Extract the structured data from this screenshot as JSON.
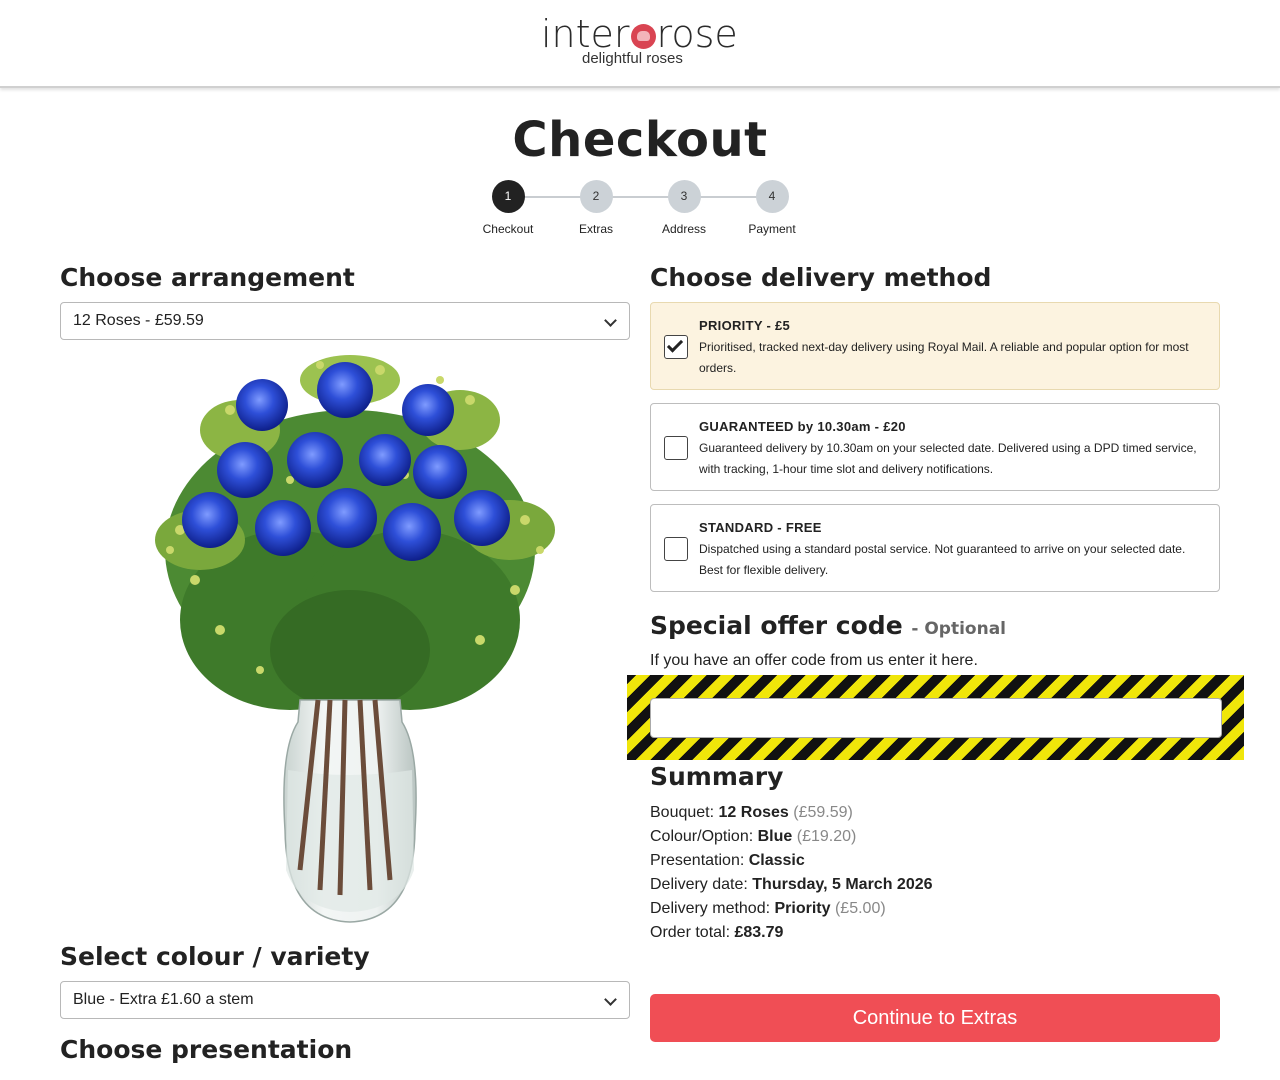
{
  "brand": {
    "name_prefix": "inter",
    "name_suffix": "rose",
    "tagline": "delightful roses"
  },
  "page": {
    "title": "Checkout"
  },
  "steps": [
    {
      "number": "1",
      "label": "Checkout",
      "active": true
    },
    {
      "number": "2",
      "label": "Extras",
      "active": false
    },
    {
      "number": "3",
      "label": "Address",
      "active": false
    },
    {
      "number": "4",
      "label": "Payment",
      "active": false
    }
  ],
  "arrangement": {
    "heading": "Choose arrangement",
    "selected": "12 Roses - £59.59"
  },
  "colour": {
    "heading": "Select colour / variety",
    "selected": "Blue - Extra £1.60 a stem"
  },
  "presentation": {
    "heading": "Choose presentation"
  },
  "delivery": {
    "heading": "Choose delivery method",
    "options": [
      {
        "title": "PRIORITY - £5",
        "description": "Prioritised, tracked next-day delivery using Royal Mail. A reliable and popular option for most orders.",
        "checked": true
      },
      {
        "title": "GUARANTEED by 10.30am - £20",
        "description": "Guaranteed delivery by 10.30am on your selected date. Delivered using a DPD timed service, with tracking, 1-hour time slot and delivery notifications.",
        "checked": false
      },
      {
        "title": "STANDARD - FREE",
        "description": "Dispatched using a standard postal service. Not guaranteed to arrive on your selected date. Best for flexible delivery.",
        "checked": false
      }
    ]
  },
  "offer": {
    "heading": "Special offer code",
    "optional_label": "- Optional",
    "help": "If you have an offer code from us enter it here.",
    "value": "",
    "placeholder": ""
  },
  "summary": {
    "heading": "Summary",
    "bouquet_label": "Bouquet:",
    "bouquet_value": "12 Roses",
    "bouquet_price": "(£59.59)",
    "colour_label": "Colour/Option:",
    "colour_value": "Blue",
    "colour_price": "(£19.20)",
    "presentation_label": "Presentation:",
    "presentation_value": "Classic",
    "date_label": "Delivery date:",
    "date_value": "Thursday, 5 March 2026",
    "method_label": "Delivery method:",
    "method_value": "Priority",
    "method_price": "(£5.00)",
    "total_label": "Order total:",
    "total_value": "£83.79"
  },
  "cta": {
    "label": "Continue to Extras"
  },
  "colors": {
    "accent": "#f04e55",
    "selected_bg": "#fcf3e0",
    "rose_blue": "#2f4fd6",
    "logo_red": "#d94452"
  }
}
